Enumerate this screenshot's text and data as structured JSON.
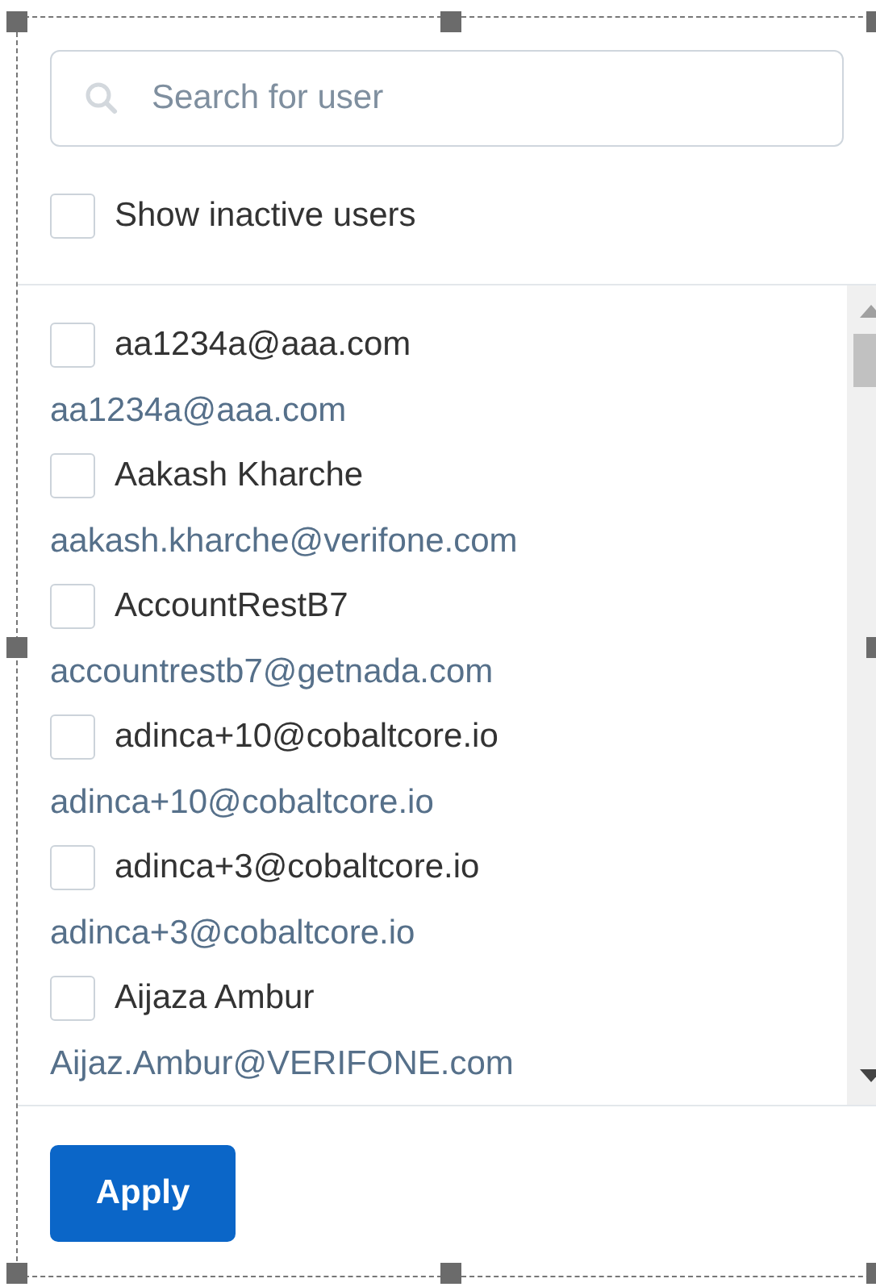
{
  "search": {
    "placeholder": "Search for user"
  },
  "show_inactive": {
    "label": "Show inactive users",
    "checked": false
  },
  "users": [
    {
      "name": "aa1234a@aaa.com",
      "email": "aa1234a@aaa.com",
      "checked": false
    },
    {
      "name": "Aakash Kharche",
      "email": "aakash.kharche@verifone.com",
      "checked": false
    },
    {
      "name": "AccountRestB7",
      "email": "accountrestb7@getnada.com",
      "checked": false
    },
    {
      "name": "adinca+10@cobaltcore.io",
      "email": "adinca+10@cobaltcore.io",
      "checked": false
    },
    {
      "name": "adinca+3@cobaltcore.io",
      "email": "adinca+3@cobaltcore.io",
      "checked": false
    },
    {
      "name": "Aijaza Ambur",
      "email": "Aijaz.Ambur@VERIFONE.com",
      "checked": false
    }
  ],
  "apply_button": "Apply"
}
